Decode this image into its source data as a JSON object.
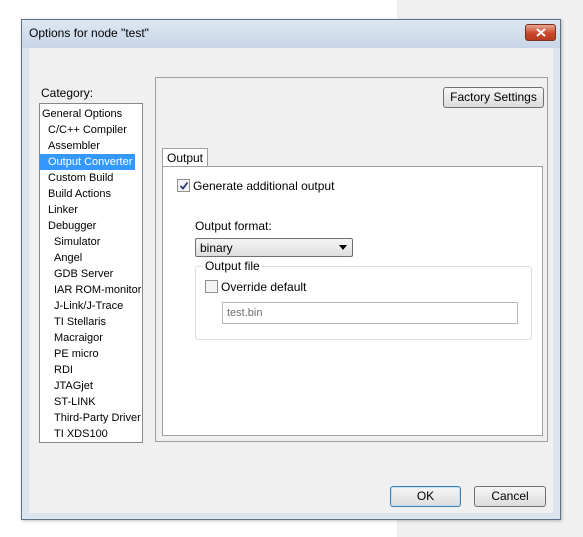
{
  "window": {
    "title": "Options for node \"test\""
  },
  "category": {
    "label": "Category:",
    "items": [
      {
        "label": "General Options",
        "indent": 0
      },
      {
        "label": "C/C++ Compiler",
        "indent": 1
      },
      {
        "label": "Assembler",
        "indent": 1
      },
      {
        "label": "Output Converter",
        "indent": 1,
        "selected": true
      },
      {
        "label": "Custom Build",
        "indent": 1
      },
      {
        "label": "Build Actions",
        "indent": 1
      },
      {
        "label": "Linker",
        "indent": 1
      },
      {
        "label": "Debugger",
        "indent": 1
      },
      {
        "label": "Simulator",
        "indent": 2
      },
      {
        "label": "Angel",
        "indent": 2
      },
      {
        "label": "GDB Server",
        "indent": 2
      },
      {
        "label": "IAR ROM-monitor",
        "indent": 2
      },
      {
        "label": "J-Link/J-Trace",
        "indent": 2
      },
      {
        "label": "TI Stellaris",
        "indent": 2
      },
      {
        "label": "Macraigor",
        "indent": 2
      },
      {
        "label": "PE micro",
        "indent": 2
      },
      {
        "label": "RDI",
        "indent": 2
      },
      {
        "label": "JTAGjet",
        "indent": 2
      },
      {
        "label": "ST-LINK",
        "indent": 2
      },
      {
        "label": "Third-Party Driver",
        "indent": 2
      },
      {
        "label": "TI XDS100",
        "indent": 2
      }
    ]
  },
  "panel": {
    "factory_settings": "Factory Settings",
    "tab": "Output",
    "generate": {
      "label": "Generate additional output",
      "checked": true
    },
    "output_format": {
      "label": "Output format:",
      "value": "binary"
    },
    "output_file": {
      "title": "Output file",
      "override": {
        "label": "Override default",
        "checked": false
      },
      "filename": "test.bin"
    }
  },
  "buttons": {
    "ok": "OK",
    "cancel": "Cancel"
  }
}
